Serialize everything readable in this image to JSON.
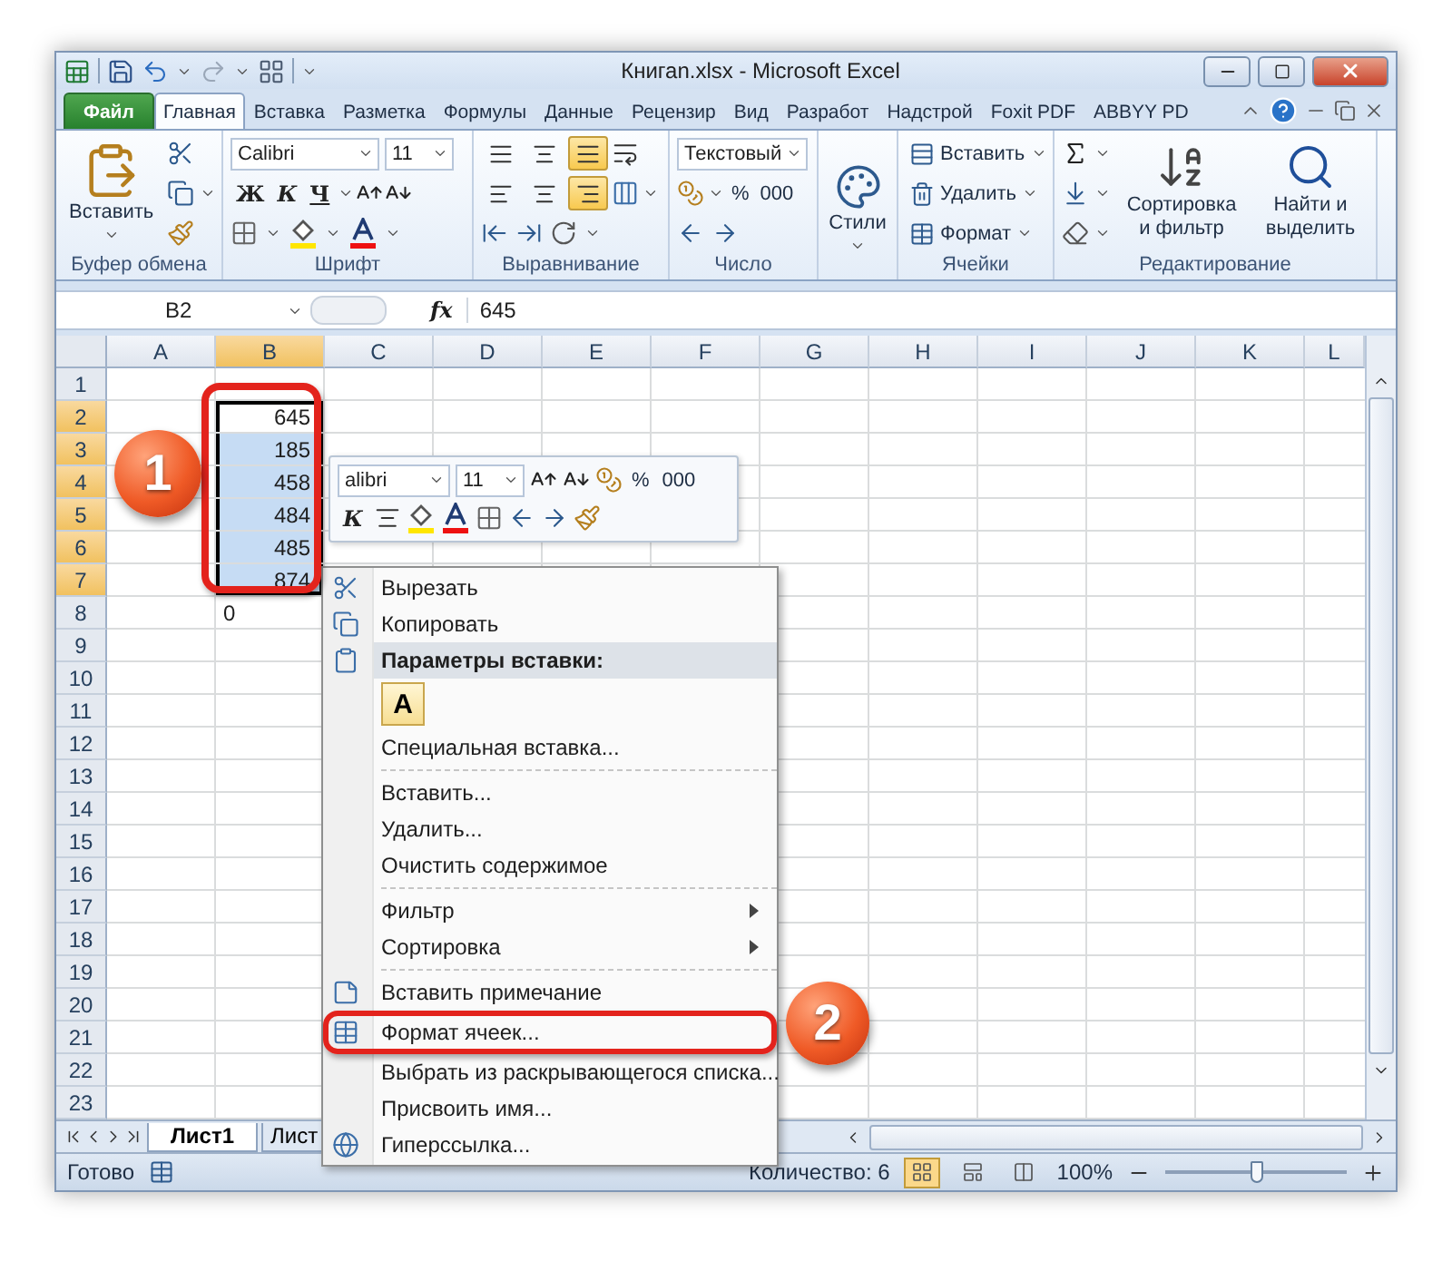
{
  "title_bar": {
    "title": "Книгаn.xlsx - Microsoft Excel"
  },
  "tabs": [
    {
      "label": "Файл",
      "kind": "file",
      "selected": false
    },
    {
      "label": "Главная",
      "kind": "tab",
      "selected": true
    },
    {
      "label": "Вставка",
      "kind": "tab",
      "selected": false
    },
    {
      "label": "Разметка",
      "kind": "tab",
      "selected": false
    },
    {
      "label": "Формулы",
      "kind": "tab",
      "selected": false
    },
    {
      "label": "Данные",
      "kind": "tab",
      "selected": false
    },
    {
      "label": "Рецензир",
      "kind": "tab",
      "selected": false
    },
    {
      "label": "Вид",
      "kind": "tab",
      "selected": false
    },
    {
      "label": "Разработ",
      "kind": "tab",
      "selected": false
    },
    {
      "label": "Надстрой",
      "kind": "tab",
      "selected": false
    },
    {
      "label": "Foxit PDF",
      "kind": "tab",
      "selected": false
    },
    {
      "label": "ABBYY PD",
      "kind": "tab",
      "selected": false
    }
  ],
  "ribbon": {
    "clipboard": {
      "label": "Буфер обмена",
      "paste": "Вставить"
    },
    "font": {
      "label": "Шрифт",
      "font": "Calibri",
      "size": "11",
      "bold": "Ж",
      "italic": "К",
      "underline": "Ч"
    },
    "alignment": {
      "label": "Выравнивание",
      "vertical": [
        {
          "selected": false
        },
        {
          "selected": false
        },
        {
          "selected": true
        }
      ],
      "horizontal": [
        {
          "selected": false
        },
        {
          "selected": false
        },
        {
          "selected": true
        }
      ]
    },
    "number": {
      "label": "Число",
      "format": "Текстовый",
      "percent": "%",
      "thousands": "000"
    },
    "styles": {
      "button": "Стили"
    },
    "cells": {
      "label": "Ячейки",
      "buttons": [
        "Вставить",
        "Удалить",
        "Формат"
      ]
    },
    "editing": {
      "label": "Редактирование",
      "sort": "Сортировка и фильтр",
      "find": "Найти и выделить"
    }
  },
  "formula_bar": {
    "name_box": "B2",
    "function_label": "fx",
    "value": "645"
  },
  "columns": [
    {
      "label": "A",
      "selected": false
    },
    {
      "label": "B",
      "selected": true
    },
    {
      "label": "C",
      "selected": false
    },
    {
      "label": "D",
      "selected": false
    },
    {
      "label": "E",
      "selected": false
    },
    {
      "label": "F",
      "selected": false
    },
    {
      "label": "G",
      "selected": false
    },
    {
      "label": "H",
      "selected": false
    },
    {
      "label": "I",
      "selected": false
    },
    {
      "label": "J",
      "selected": false
    },
    {
      "label": "K",
      "selected": false
    },
    {
      "label": "L",
      "selected": false
    }
  ],
  "rows": [
    {
      "label": "1",
      "selected": false
    },
    {
      "label": "2",
      "value": "645",
      "kind": "number",
      "selected": true
    },
    {
      "label": "3",
      "value": "185",
      "kind": "number",
      "selected": true
    },
    {
      "label": "4",
      "value": "458",
      "kind": "number",
      "selected": true
    },
    {
      "label": "5",
      "value": "484",
      "kind": "number",
      "selected": true
    },
    {
      "label": "6",
      "value": "485",
      "kind": "number",
      "selected": true
    },
    {
      "label": "7",
      "value": "874",
      "kind": "number",
      "selected": true
    },
    {
      "label": "8",
      "value": "0",
      "kind": "text",
      "selected": false
    },
    {
      "label": "9",
      "selected": false
    },
    {
      "label": "10",
      "selected": false
    },
    {
      "label": "11",
      "selected": false
    },
    {
      "label": "12",
      "selected": false
    },
    {
      "label": "13",
      "selected": false
    },
    {
      "label": "14",
      "selected": false
    },
    {
      "label": "15",
      "selected": false
    },
    {
      "label": "16",
      "selected": false
    },
    {
      "label": "17",
      "selected": false
    },
    {
      "label": "18",
      "selected": false
    },
    {
      "label": "19",
      "selected": false
    },
    {
      "label": "20",
      "selected": false
    },
    {
      "label": "21",
      "selected": false
    },
    {
      "label": "22",
      "selected": false
    },
    {
      "label": "23",
      "selected": false
    }
  ],
  "mini_toolbar": {
    "font": "alibri",
    "size": "11",
    "italic": "К",
    "percent": "%",
    "thousands": "000"
  },
  "context_menu": [
    {
      "kind": "command",
      "label": "Вырезать",
      "highlighted": false
    },
    {
      "kind": "command",
      "label": "Копировать",
      "highlighted": false
    },
    {
      "kind": "header",
      "label": "Параметры вставки:"
    },
    {
      "kind": "paste",
      "label": "A"
    },
    {
      "kind": "command",
      "label": "Специальная вставка...",
      "highlighted": false
    },
    {
      "kind": "separator"
    },
    {
      "kind": "command",
      "label": "Вставить...",
      "highlighted": false
    },
    {
      "kind": "command",
      "label": "Удалить...",
      "highlighted": false
    },
    {
      "kind": "command",
      "label": "Очистить содержимое",
      "highlighted": false
    },
    {
      "kind": "separator"
    },
    {
      "kind": "submenu",
      "label": "Фильтр",
      "highlighted": false
    },
    {
      "kind": "submenu",
      "label": "Сортировка",
      "highlighted": false
    },
    {
      "kind": "separator"
    },
    {
      "kind": "command",
      "label": "Вставить примечание",
      "highlighted": false
    },
    {
      "kind": "command",
      "label": "Формат ячеек...",
      "highlighted": true
    },
    {
      "kind": "command",
      "label": "Выбрать из раскрывающегося списка...",
      "highlighted": false
    },
    {
      "kind": "command",
      "label": "Присвоить имя...",
      "highlighted": false
    },
    {
      "kind": "command",
      "label": "Гиперссылка...",
      "highlighted": false
    }
  ],
  "sheet_tabs": [
    {
      "label": "Лист1",
      "selected": true
    },
    {
      "label": "Лист",
      "selected": false
    }
  ],
  "status_bar": {
    "status": "Готово",
    "count": "Количество: 6",
    "views": [
      {
        "selected": true
      },
      {
        "selected": false
      },
      {
        "selected": false
      }
    ],
    "zoom": "100%",
    "zoom_slider": {
      "level": 0.5
    }
  },
  "annotations": [
    {
      "label": "1"
    },
    {
      "label": "2"
    }
  ]
}
